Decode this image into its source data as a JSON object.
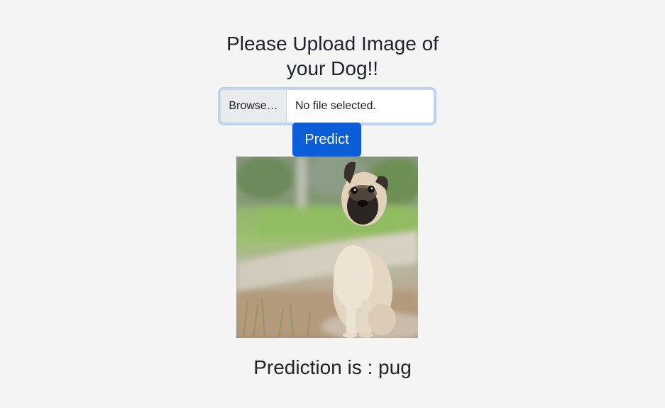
{
  "page": {
    "heading_line1": "Please Upload Image of",
    "heading_line2": "your Dog!!"
  },
  "upload": {
    "browse_label": "Browse…",
    "file_status": "No file selected."
  },
  "predict_button": {
    "label": "Predict"
  },
  "result": {
    "label": "Prediction is : pug"
  },
  "colors": {
    "background": "#f4f4f4",
    "primary": "#0b5ed7",
    "text": "#212529"
  }
}
